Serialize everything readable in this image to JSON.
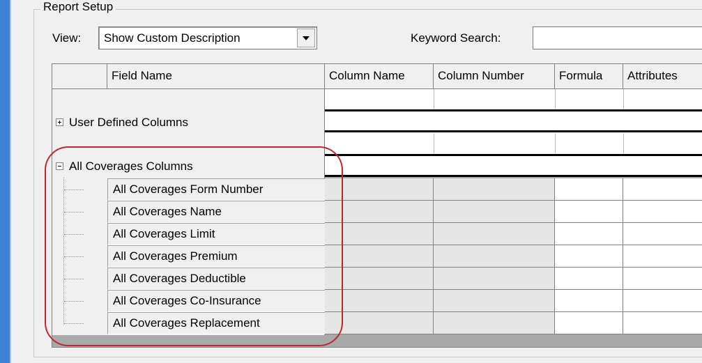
{
  "report_setup": {
    "title": "Report Setup",
    "view_label": "View:",
    "view_selected": "Show Custom Description",
    "keyword_label": "Keyword Search:",
    "keyword_value": ""
  },
  "grid": {
    "headers": [
      "Field Name",
      "Column Name",
      "Column Number",
      "Formula",
      "Attributes"
    ],
    "groups": [
      {
        "label": "User Defined Columns",
        "expanded": false
      },
      {
        "label": "All Coverages Columns",
        "expanded": true
      }
    ],
    "rows": [
      "All Coverages Form Number",
      "All Coverages Name",
      "All Coverages Limit",
      "All Coverages Premium",
      "All Coverages Deductible",
      "All Coverages Co-Insurance",
      "All Coverages Replacement"
    ]
  },
  "colors": {
    "highlight": "#c0272d",
    "side_bar": "#3d7fd1"
  }
}
